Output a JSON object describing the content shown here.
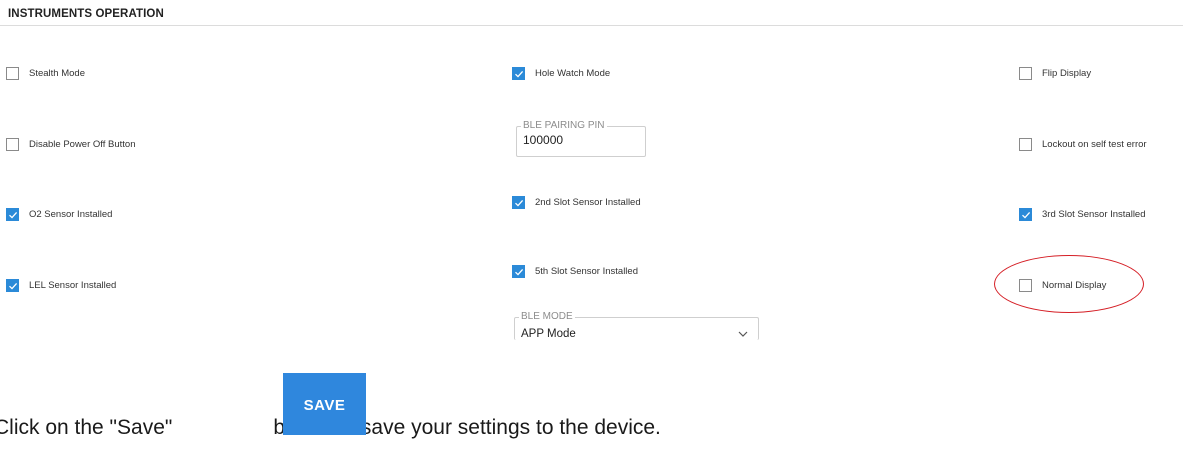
{
  "section": {
    "title": "INSTRUMENTS OPERATION"
  },
  "checkboxes": {
    "stealth_mode": {
      "label": "Stealth Mode",
      "checked": false
    },
    "hole_watch_mode": {
      "label": "Hole Watch Mode",
      "checked": true
    },
    "flip_display": {
      "label": "Flip Display",
      "checked": false
    },
    "disable_power_off": {
      "label": "Disable Power Off Button",
      "checked": false
    },
    "lockout_self_test": {
      "label": "Lockout on self test error",
      "checked": false
    },
    "o2_sensor": {
      "label": "O2 Sensor Installed",
      "checked": true
    },
    "slot2_sensor": {
      "label": "2nd Slot Sensor Installed",
      "checked": true
    },
    "slot3_sensor": {
      "label": "3rd Slot Sensor Installed",
      "checked": true
    },
    "lel_sensor": {
      "label": "LEL Sensor Installed",
      "checked": true
    },
    "slot5_sensor": {
      "label": "5th Slot Sensor Installed",
      "checked": true
    },
    "normal_display": {
      "label": "Normal Display",
      "checked": false
    }
  },
  "ble_pairing_pin": {
    "legend": "BLE PAIRING PIN",
    "value": "100000"
  },
  "ble_mode": {
    "legend": "BLE MODE",
    "value": "APP Mode"
  },
  "instruction": {
    "before": "Click on the \"Save\"",
    "after": "button to save your settings to the device.",
    "save_label": "SAVE"
  },
  "colors": {
    "accent": "#2b8ad8",
    "highlight": "#d51f26",
    "save_button": "#2f87dd"
  }
}
